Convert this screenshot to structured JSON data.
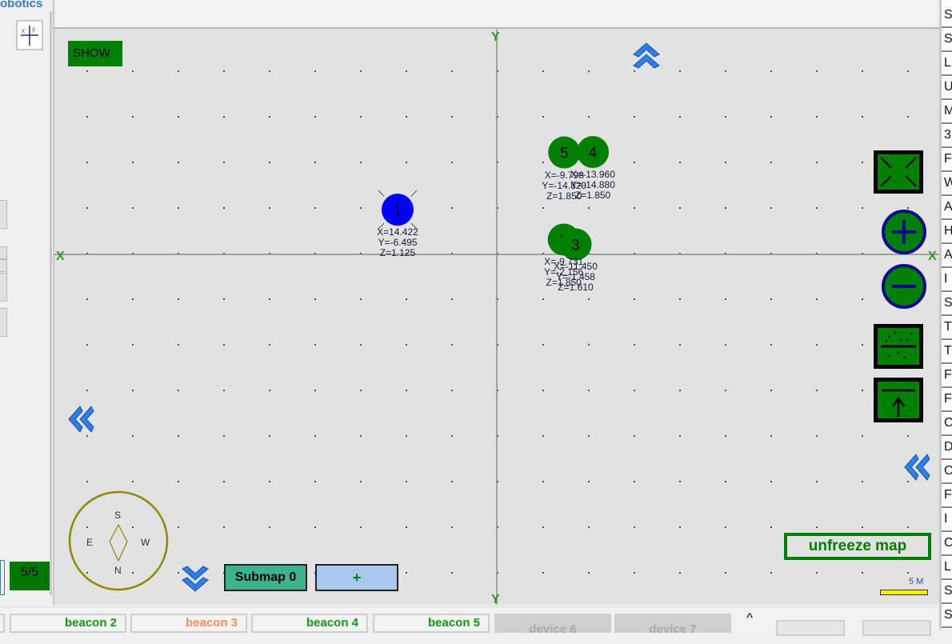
{
  "app": {
    "brand_text": "obotics"
  },
  "toolbar": {
    "show_label": "SHOW",
    "axes_icon": "xy-axes-icon"
  },
  "pager": {
    "page_count": "5/5"
  },
  "map": {
    "axis_labels": {
      "x": "X",
      "y": "Y"
    },
    "beacons": [
      {
        "id": "1",
        "x": "14.422",
        "y": "-6.495",
        "z": "1.125",
        "color": "#0000ff",
        "selected": true
      },
      {
        "id": "2",
        "x": "-9.731",
        "y": "-2.156",
        "z": "1.850",
        "color": "#008000",
        "selected": false
      },
      {
        "id": "3",
        "x": "-11.450",
        "y": "-1.458",
        "z": "1.610",
        "color": "#008000",
        "selected": false
      },
      {
        "id": "4",
        "x": "-13.960",
        "y": "-14.880",
        "z": "1.850",
        "color": "#008000",
        "selected": false
      },
      {
        "id": "5",
        "x": "-9.798",
        "y": "-14.820",
        "z": "1.850",
        "color": "#008000",
        "selected": false
      }
    ],
    "compass": {
      "top": "S",
      "bottom": "N",
      "left": "E",
      "right": "W"
    },
    "unfreeze_label": "unfreeze map",
    "scale_label": "5 M",
    "submap_label": "Submap 0",
    "add_submap_label": "+",
    "controls": [
      "fit-to-screen-icon",
      "zoom-in-icon",
      "zoom-out-icon",
      "floor-split-icon",
      "floor-up-icon"
    ]
  },
  "right_list": {
    "items": [
      "S",
      "S",
      "L",
      "U",
      "M",
      "3",
      "F",
      "W",
      "A",
      "H",
      "A",
      "I",
      "S",
      "T",
      "T",
      "F",
      "F",
      "C",
      "D",
      "C",
      "F",
      "I",
      "C",
      "L",
      "S",
      "S"
    ]
  },
  "tabs": [
    {
      "label": "beacon 2",
      "color": "#119911",
      "disabled": false
    },
    {
      "label": "beacon 3",
      "color": "#ff8c5a",
      "disabled": false
    },
    {
      "label": "beacon 4",
      "color": "#119911",
      "disabled": false
    },
    {
      "label": "beacon 5",
      "color": "#119911",
      "disabled": false
    },
    {
      "label": "device 6",
      "color": "#aaaaaa",
      "disabled": true
    },
    {
      "label": "device 7",
      "color": "#aaaaaa",
      "disabled": true
    }
  ],
  "bottom": {
    "caret": "^"
  }
}
